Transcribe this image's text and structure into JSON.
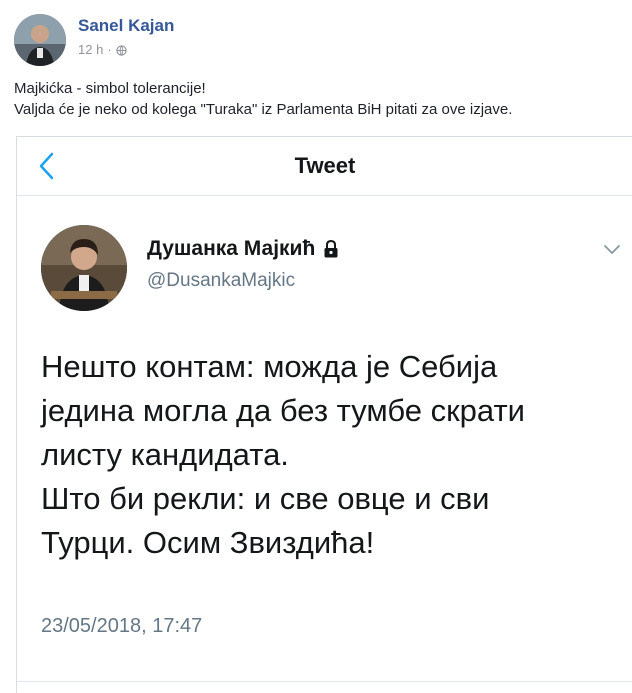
{
  "post": {
    "author": "Sanel Kajan",
    "time": "12 h",
    "separator": "·",
    "privacy_icon": "globe-icon",
    "text_lines": [
      "Majkićka - simbol tolerancije!",
      "Valjda će je neko od kolega \"Turaka\" iz Parlamenta BiH pitati za ove izjave."
    ]
  },
  "tweet": {
    "nav_title": "Tweet",
    "back_icon": "back-chevron-icon",
    "name": "Душанка Мајкић",
    "handle": "@DusankaMajkic",
    "lock_icon": "lock-icon",
    "menu_icon": "chevron-down-icon",
    "body_lines": [
      "Нешто контам: можда је Себија",
      "једина могла да без тумбе скрати",
      "листу кандидата.",
      "Што би рекли: и све овце и сви",
      "Турци. Осим Звиздића!"
    ],
    "timestamp": "23/05/2018, 17:47",
    "accent_color": "#1da1f2"
  }
}
